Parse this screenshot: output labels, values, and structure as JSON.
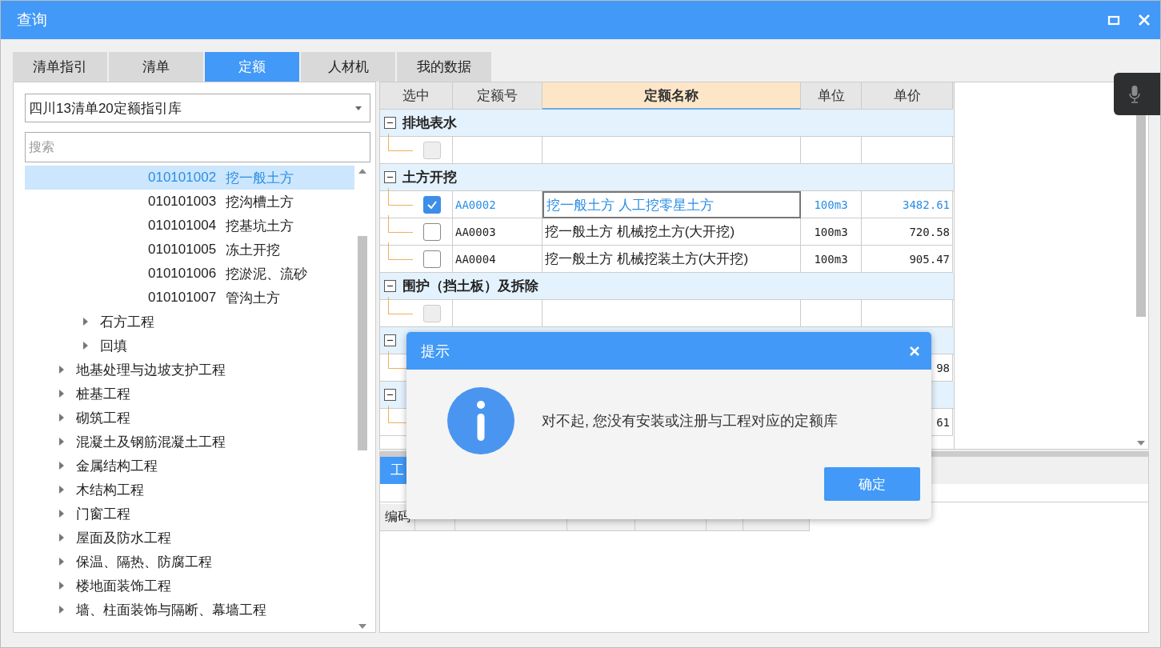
{
  "window": {
    "title": "查询"
  },
  "tabs": [
    {
      "label": "清单指引",
      "selected": false
    },
    {
      "label": "清单",
      "selected": false
    },
    {
      "label": "定额",
      "selected": true
    },
    {
      "label": "人材机",
      "selected": false
    },
    {
      "label": "我的数据",
      "selected": false
    }
  ],
  "library_select": {
    "value": "四川13清单20定额指引库"
  },
  "search": {
    "placeholder": "搜索"
  },
  "tree": {
    "items": [
      {
        "children": [
          {
            "children": [
              {
                "code": "010101002",
                "label": "挖一般土方",
                "selected": true
              },
              {
                "code": "010101003",
                "label": "挖沟槽土方",
                "selected": false
              },
              {
                "code": "010101004",
                "label": "挖基坑土方",
                "selected": false
              },
              {
                "code": "010101005",
                "label": "冻土开挖",
                "selected": false
              },
              {
                "code": "010101006",
                "label": "挖淤泥、流砂",
                "selected": false
              },
              {
                "code": "010101007",
                "label": "管沟土方",
                "selected": false
              }
            ]
          },
          {
            "label": "石方工程",
            "expanded": false
          },
          {
            "label": "回填",
            "expanded": false
          }
        ]
      },
      {
        "label": "地基处理与边坡支护工程",
        "expanded": false
      },
      {
        "label": "桩基工程",
        "expanded": false
      },
      {
        "label": "砌筑工程",
        "expanded": false
      },
      {
        "label": "混凝土及钢筋混凝土工程",
        "expanded": false
      },
      {
        "label": "金属结构工程",
        "expanded": false
      },
      {
        "label": "木结构工程",
        "expanded": false
      },
      {
        "label": "门窗工程",
        "expanded": false
      },
      {
        "label": "屋面及防水工程",
        "expanded": false
      },
      {
        "label": "保温、隔热、防腐工程",
        "expanded": false
      },
      {
        "label": "楼地面装饰工程",
        "expanded": false
      },
      {
        "label": "墙、柱面装饰与隔断、幕墙工程",
        "expanded": false
      }
    ]
  },
  "quota_table": {
    "columns": [
      {
        "label": "选中",
        "sorted": false
      },
      {
        "label": "定额号",
        "sorted": false
      },
      {
        "label": "定额名称",
        "sorted": true
      },
      {
        "label": "单位",
        "sorted": false
      },
      {
        "label": "单价",
        "sorted": false
      }
    ],
    "groups": [
      {
        "label": "排地表水",
        "expanded": true,
        "rows": [
          {
            "checked": false,
            "disabled": true,
            "selected": false
          }
        ]
      },
      {
        "label": "土方开挖",
        "expanded": true,
        "rows": [
          {
            "checked": true,
            "disabled": false,
            "selected": true,
            "code": "AA0002",
            "name": "挖一般土方 人工挖零星土方",
            "unit": "100m3",
            "price": "3482.61"
          },
          {
            "checked": false,
            "disabled": false,
            "selected": false,
            "code": "AA0003",
            "name": "挖一般土方 机械挖土方(大开挖)",
            "unit": "100m3",
            "price": "720.58"
          },
          {
            "checked": false,
            "disabled": false,
            "selected": false,
            "code": "AA0004",
            "name": "挖一般土方 机械挖装土方(大开挖)",
            "unit": "100m3",
            "price": "905.47"
          }
        ]
      },
      {
        "label": "围护（挡土板）及拆除",
        "expanded": true,
        "rows": [
          {
            "checked": false,
            "disabled": true,
            "selected": false
          }
        ]
      },
      {
        "expanded": true,
        "rows": [
          {
            "price": "98"
          }
        ]
      },
      {
        "expanded": true,
        "rows": [
          {
            "price": "61"
          }
        ]
      }
    ]
  },
  "bottom_panel": {
    "tabs": [
      {
        "label": "工",
        "selected": true
      }
    ],
    "columns": [
      {
        "label": "编码"
      },
      {},
      {},
      {},
      {},
      {},
      {}
    ]
  },
  "dialog": {
    "title": "提示",
    "message": "对不起, 您没有安装或注册与工程对应的定额库",
    "buttons": [
      "确定"
    ]
  }
}
